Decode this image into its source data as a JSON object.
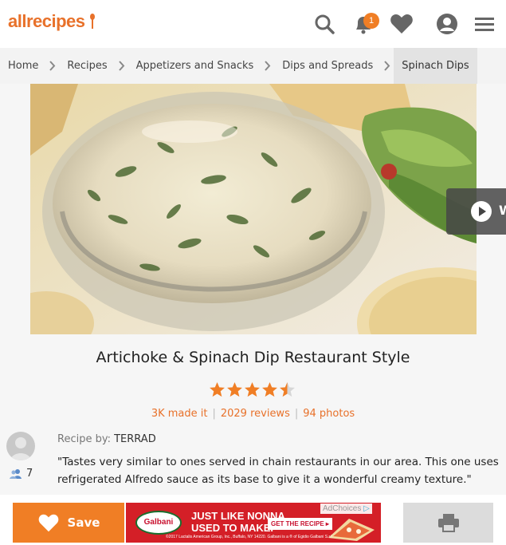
{
  "header": {
    "logo_text": "allrecipes",
    "notification_count": "1",
    "icons": [
      "search-icon",
      "bell-icon",
      "heart-icon",
      "profile-icon",
      "menu-icon"
    ]
  },
  "breadcrumb": {
    "items": [
      {
        "label": "Home"
      },
      {
        "label": "Recipes"
      },
      {
        "label": "Appetizers and Snacks"
      },
      {
        "label": "Dips and Spreads"
      },
      {
        "label": "Spinach Dips"
      }
    ]
  },
  "recipe": {
    "title": "Artichoke & Spinach Dip Restaurant Style",
    "rating": 4.5,
    "rating_max": 5,
    "made_it": "3K made it",
    "reviews": "2029 reviews",
    "photos": "94 photos",
    "byline_label": "Recipe by:",
    "author": "TERRAD",
    "followers": "7",
    "description": "\"Tastes very similar to ones served in chain restaurants in our area. This one uses refrigerated Alfredo sauce as its base to give it a wonderful creamy texture.\""
  },
  "video_button": {
    "icon": "play-icon",
    "label_fragment": "W"
  },
  "actions": {
    "save_label": "Save",
    "print_icon": "print-icon"
  },
  "ad": {
    "brand": "Galbani",
    "headline_1": "JUST LIKE NONNA",
    "headline_2": "USED TO MAKE.",
    "cta": "GET THE RECIPE ▸",
    "ad_choices": "AdChoices",
    "legal": "©2017 Lactalis American Group, Inc., Buffalo, NY 14220. Galbani is a ® of Egidio Galbani S.r.l."
  },
  "colors": {
    "accent": "#f07e25",
    "ad_red": "#d41f27"
  }
}
